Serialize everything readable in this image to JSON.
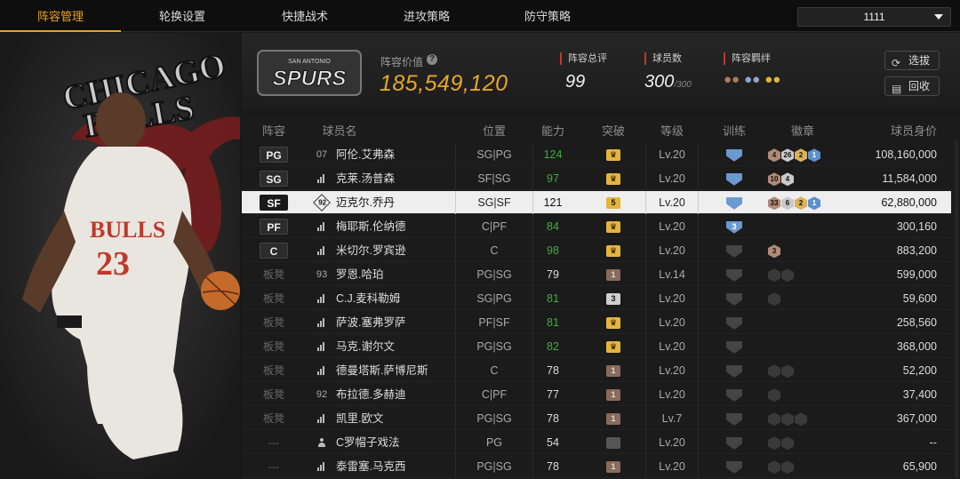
{
  "tabs": [
    "阵容管理",
    "轮换设置",
    "快捷战术",
    "进攻策略",
    "防守策略"
  ],
  "active_tab": 0,
  "selector": {
    "value": "1111"
  },
  "team_logo": {
    "text": "SPURS",
    "sub": "SAN ANTONIO"
  },
  "art_text": {
    "line1": "CHICAGO",
    "line2": "BULLS",
    "jersey_team": "BULLS",
    "jersey_number": "23"
  },
  "lineup_value": {
    "label": "阵容价值",
    "value": "185,549,120"
  },
  "stats": {
    "rating_label": "阵容总评",
    "rating": "99",
    "count_label": "球员数",
    "count": "300",
    "count_max": "/300",
    "bond_label": "阵容羁绊"
  },
  "buttons": {
    "pick": "选拔",
    "recycle": "回收"
  },
  "columns": [
    "阵容",
    "球员名",
    "位置",
    "能力",
    "突破",
    "等级",
    "训练",
    "徽章",
    "球员身价"
  ],
  "rows": [
    {
      "slot": "PG",
      "num": "07",
      "name": "阿伦.艾弗森",
      "pos": "SG|PG",
      "ability": "124",
      "up": true,
      "brk": "crown",
      "brkc": "gold",
      "lvl": "Lv.20",
      "train": "",
      "trainc": "blue",
      "badges": [
        [
          "4",
          "br"
        ],
        [
          "26",
          "sv"
        ],
        [
          "2",
          "gd"
        ],
        [
          "1",
          "bl"
        ]
      ],
      "price": "108,160,000"
    },
    {
      "slot": "SG",
      "num": "",
      "name": "克莱.汤普森",
      "pos": "SF|SG",
      "ability": "97",
      "up": true,
      "brk": "crown",
      "brkc": "gold",
      "lvl": "Lv.20",
      "train": "",
      "trainc": "blue",
      "badges": [
        [
          "10",
          "br"
        ],
        [
          "4",
          "sv"
        ]
      ],
      "price": "11,584,000"
    },
    {
      "slot": "SF",
      "num": "92",
      "name": "迈克尔.乔丹",
      "pos": "SG|SF",
      "ability": "121",
      "up": false,
      "brk": "5",
      "brkc": "gold",
      "lvl": "Lv.20",
      "train": "",
      "trainc": "blue",
      "badges": [
        [
          "33",
          "br"
        ],
        [
          "6",
          "sv"
        ],
        [
          "2",
          "gd"
        ],
        [
          "1",
          "bl"
        ]
      ],
      "price": "62,880,000",
      "sel": true
    },
    {
      "slot": "PF",
      "num": "",
      "name": "梅耶斯.伦纳德",
      "pos": "C|PF",
      "ability": "84",
      "up": true,
      "brk": "crown",
      "brkc": "gold",
      "lvl": "Lv.20",
      "train": "3",
      "trainc": "blue",
      "badges": [],
      "price": "300,160"
    },
    {
      "slot": "C",
      "num": "",
      "name": "米切尔.罗宾逊",
      "pos": "C",
      "ability": "98",
      "up": true,
      "brk": "crown",
      "brkc": "gold",
      "lvl": "Lv.20",
      "train": "",
      "trainc": "gray",
      "badges": [
        [
          "3",
          "br"
        ]
      ],
      "price": "883,200"
    },
    {
      "slot": "板凳",
      "num": "93",
      "name": "罗恩.哈珀",
      "pos": "PG|SG",
      "ability": "79",
      "up": false,
      "brk": "1",
      "brkc": "bronze",
      "lvl": "Lv.14",
      "train": "",
      "trainc": "gray",
      "badges": [
        [
          "",
          "dk"
        ],
        [
          "",
          "dk"
        ]
      ],
      "price": "599,000"
    },
    {
      "slot": "板凳",
      "num": "",
      "name": "C.J.麦科勒姆",
      "pos": "SG|PG",
      "ability": "81",
      "up": true,
      "brk": "3",
      "brkc": "silver",
      "lvl": "Lv.20",
      "train": "",
      "trainc": "gray",
      "badges": [
        [
          "",
          "dk"
        ]
      ],
      "price": "59,600"
    },
    {
      "slot": "板凳",
      "num": "",
      "name": "萨波.塞弗罗萨",
      "pos": "PF|SF",
      "ability": "81",
      "up": true,
      "brk": "crown",
      "brkc": "gold",
      "lvl": "Lv.20",
      "train": "",
      "trainc": "gray",
      "badges": [],
      "price": "258,560"
    },
    {
      "slot": "板凳",
      "num": "",
      "name": "马克.谢尔文",
      "pos": "PG|SG",
      "ability": "82",
      "up": true,
      "brk": "crown",
      "brkc": "gold",
      "lvl": "Lv.20",
      "train": "",
      "trainc": "gray",
      "badges": [],
      "price": "368,000"
    },
    {
      "slot": "板凳",
      "num": "",
      "name": "德曼塔斯.萨博尼斯",
      "pos": "C",
      "ability": "78",
      "up": false,
      "brk": "1",
      "brkc": "bronze",
      "lvl": "Lv.20",
      "train": "",
      "trainc": "gray",
      "badges": [
        [
          "",
          "dk"
        ],
        [
          "",
          "dk"
        ]
      ],
      "price": "52,200"
    },
    {
      "slot": "板凳",
      "num": "92",
      "name": "布拉德.多赫迪",
      "pos": "C|PF",
      "ability": "77",
      "up": false,
      "brk": "1",
      "brkc": "bronze",
      "lvl": "Lv.20",
      "train": "",
      "trainc": "gray",
      "badges": [
        [
          "",
          "dk"
        ]
      ],
      "price": "37,400"
    },
    {
      "slot": "板凳",
      "num": "",
      "name": "凯里.欧文",
      "pos": "PG|SG",
      "ability": "78",
      "up": false,
      "brk": "1",
      "brkc": "bronze",
      "lvl": "Lv.7",
      "train": "",
      "trainc": "gray",
      "badges": [
        [
          "",
          "dk"
        ],
        [
          "",
          "dk"
        ],
        [
          "",
          "dk"
        ]
      ],
      "price": "367,000"
    },
    {
      "slot": "---",
      "num": "",
      "name": "C罗帽子戏法",
      "pos": "PG",
      "ability": "54",
      "up": false,
      "brk": "",
      "brkc": "gray",
      "lvl": "Lv.20",
      "train": "",
      "trainc": "gray",
      "badges": [
        [
          "",
          "dk"
        ],
        [
          "",
          "dk"
        ]
      ],
      "price": "--",
      "person": true
    },
    {
      "slot": "---",
      "num": "",
      "name": "泰雷塞.马克西",
      "pos": "PG|SG",
      "ability": "78",
      "up": false,
      "brk": "1",
      "brkc": "bronze",
      "lvl": "Lv.20",
      "train": "",
      "trainc": "gray",
      "badges": [
        [
          "",
          "dk"
        ],
        [
          "",
          "dk"
        ]
      ],
      "price": "65,900"
    }
  ],
  "colors": {
    "accent": "#e8a317",
    "value": "#e6a72a",
    "green": "#3fae3f",
    "red": "#c0392b"
  }
}
